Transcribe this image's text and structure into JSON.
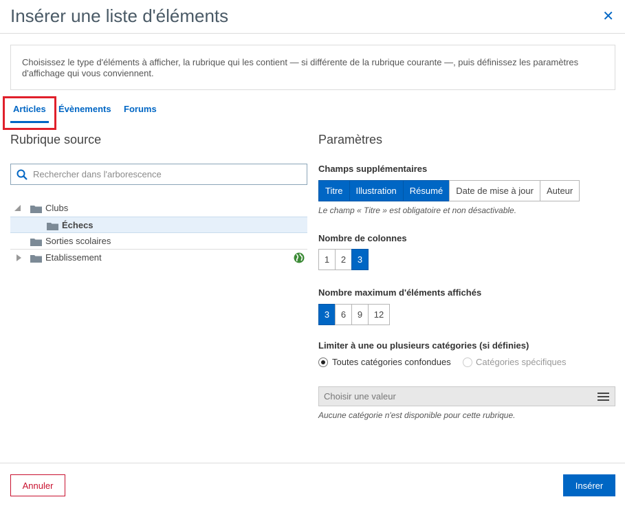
{
  "dialog": {
    "title": "Insérer une liste d'éléments",
    "close_icon": "close-icon"
  },
  "intro": "Choisissez le type d'éléments à afficher, la rubrique qui les contient — si différente de la rubrique courante —, puis définissez les paramètres d'affichage qui vous conviennent.",
  "tabs": [
    {
      "label": "Articles",
      "active": true
    },
    {
      "label": "Évènements",
      "active": false
    },
    {
      "label": "Forums",
      "active": false
    }
  ],
  "source": {
    "title": "Rubrique source",
    "search_placeholder": "Rechercher dans l'arborescence",
    "tree": [
      {
        "label": "Clubs",
        "expanded": true,
        "level": 0
      },
      {
        "label": "Échecs",
        "level": 1,
        "selected": true
      },
      {
        "label": "Sorties scolaires",
        "level": 0
      },
      {
        "label": "Etablissement",
        "level": 0,
        "collapsed": true,
        "icon": "globe-icon"
      }
    ]
  },
  "params": {
    "title": "Paramètres",
    "fields_label": "Champs supplémentaires",
    "fields": [
      {
        "label": "Titre",
        "on": true
      },
      {
        "label": "Illustration",
        "on": true
      },
      {
        "label": "Résumé",
        "on": true
      },
      {
        "label": "Date de mise à jour",
        "on": false
      },
      {
        "label": "Auteur",
        "on": false
      }
    ],
    "fields_hint": "Le champ « Titre » est obligatoire et non désactivable.",
    "columns_label": "Nombre de colonnes",
    "columns": [
      {
        "label": "1",
        "on": false
      },
      {
        "label": "2",
        "on": false
      },
      {
        "label": "3",
        "on": true
      }
    ],
    "max_label": "Nombre maximum d'éléments affichés",
    "max": [
      {
        "label": "3",
        "on": true
      },
      {
        "label": "6",
        "on": false
      },
      {
        "label": "9",
        "on": false
      },
      {
        "label": "12",
        "on": false
      }
    ],
    "categories_label": "Limiter à une ou plusieurs catégories (si définies)",
    "radio_all": "Toutes catégories confondues",
    "radio_specific": "Catégories spécifiques",
    "select_placeholder": "Choisir une valeur",
    "categories_hint": "Aucune catégorie n'est disponible pour cette rubrique."
  },
  "footer": {
    "cancel": "Annuler",
    "insert": "Insérer"
  },
  "colors": {
    "accent": "#0066c4",
    "cancel": "#c8102e",
    "highlight": "#e0202b"
  }
}
